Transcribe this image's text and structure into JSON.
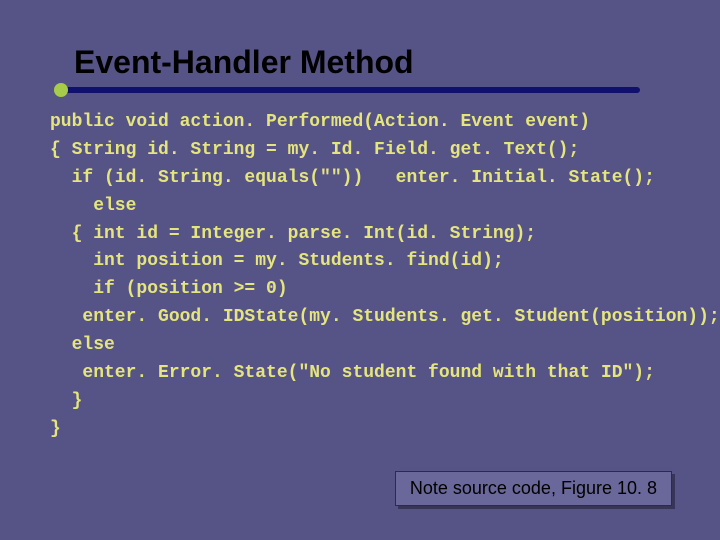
{
  "title": "Event-Handler Method",
  "code_lines": [
    "public void action. Performed(Action. Event event)",
    "{ String id. String = my. Id. Field. get. Text();",
    "  if (id. String. equals(\"\"))   enter. Initial. State();",
    "    else",
    "  { int id = Integer. parse. Int(id. String);",
    "    int position = my. Students. find(id);",
    "    if (position >= 0)",
    "   enter. Good. IDState(my. Students. get. Student(position));",
    "  else",
    "   enter. Error. State(\"No student found with that ID\");",
    "  }",
    "}"
  ],
  "note": "Note source code, Figure 10. 8"
}
